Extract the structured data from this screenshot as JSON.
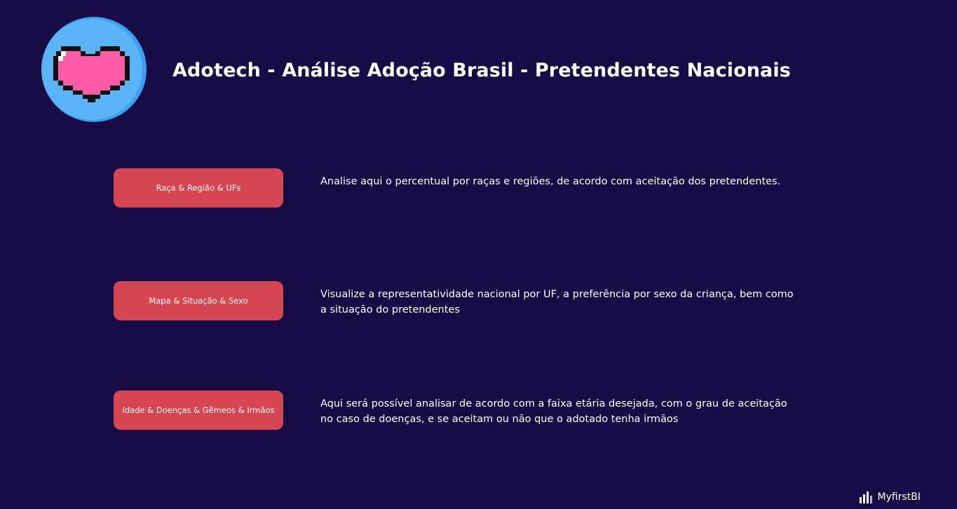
{
  "header": {
    "title": "Adotech - Análise Adoção Brasil - Pretendentes Nacionais"
  },
  "logo": {
    "icon": "pixel-heart-icon",
    "circle_color": "#4aa6f2",
    "heart_color": "#ff5ca8"
  },
  "nav": [
    {
      "label": "Raça & Região & UFs",
      "description": "Analise aqui o percentual por raças e regiões, de acordo com aceitação dos pretendentes."
    },
    {
      "label": "Mapa & Situação & Sexo",
      "description": "Visualize a representatividade nacional por UF, a preferência por sexo da criança, bem como a situação do pretendentes"
    },
    {
      "label": "Idade & Doenças & Gêmeos & Irmãos",
      "description": "Aqui será possível analisar de acordo com a faixa etária desejada, com o grau de aceitação no caso de doenças, e se aceitam ou não que o adotado tenha irmãos"
    }
  ],
  "footer": {
    "brand": "MyfirstBI",
    "icon": "bar-chart-icon"
  },
  "colors": {
    "background": "#180c47",
    "button": "#d54552",
    "text": "#ffffff"
  }
}
